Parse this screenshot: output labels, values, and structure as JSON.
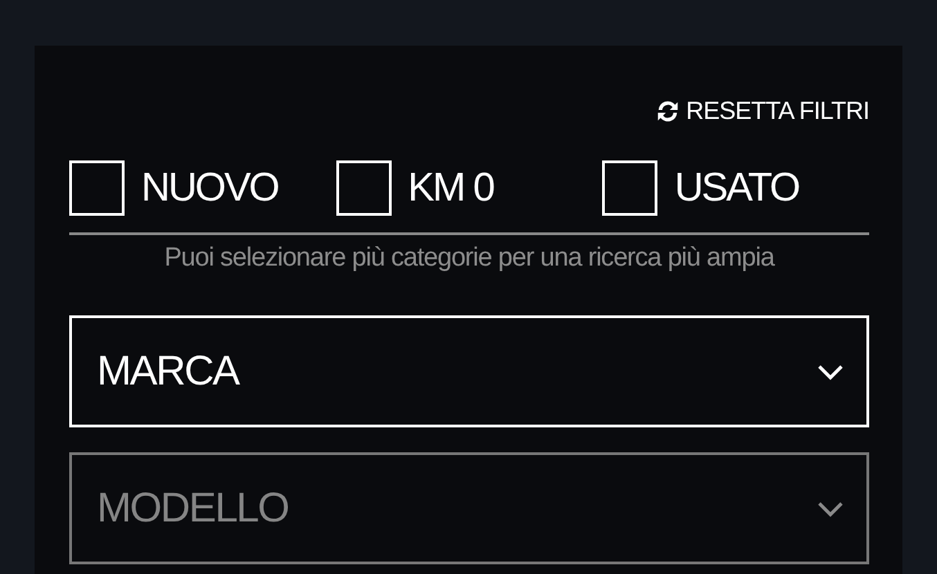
{
  "reset_button": {
    "label": "RESETTA FILTRI"
  },
  "categories": [
    {
      "label": "NUOVO",
      "checked": false
    },
    {
      "label": "KM 0",
      "checked": false
    },
    {
      "label": "USATO",
      "checked": false
    }
  ],
  "hint": "Puoi selezionare più categorie per una ricerca più ampia",
  "dropdowns": [
    {
      "label": "MARCA",
      "disabled": false
    },
    {
      "label": "MODELLO",
      "disabled": true
    }
  ]
}
